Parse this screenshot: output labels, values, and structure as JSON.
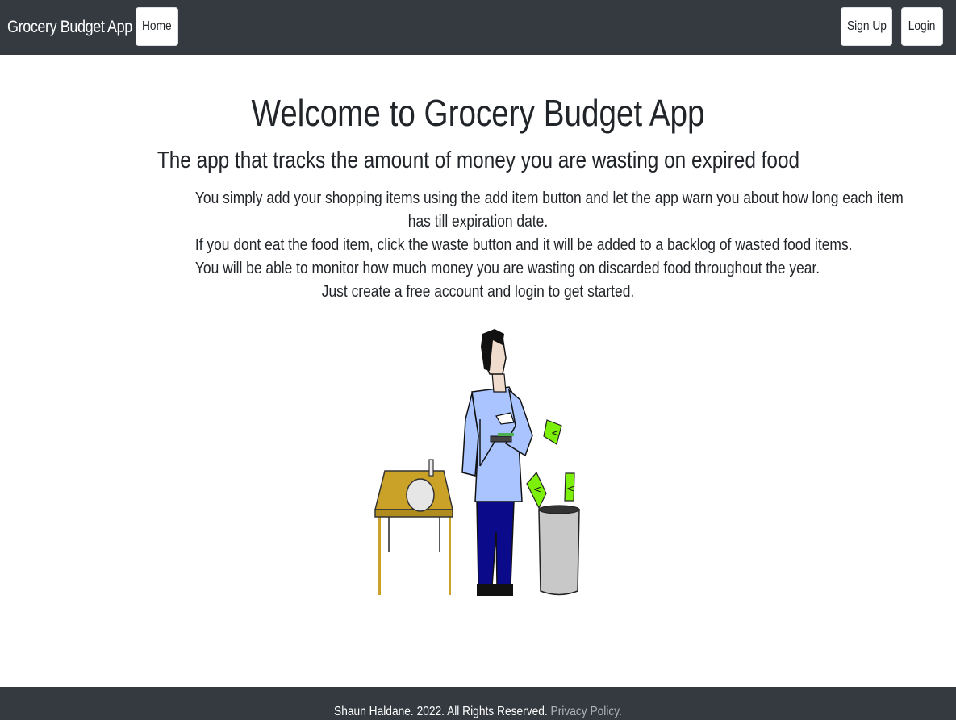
{
  "nav": {
    "brand": "Grocery Budget App",
    "home_label": "Home",
    "signup_label": "Sign Up",
    "login_label": "Login"
  },
  "hero": {
    "title": "Welcome to Grocery Budget App",
    "subtitle": "The app that tracks the amount of money you are wasting on expired food",
    "description_lines": [
      "You simply add your shopping items using the add item button and let the app warn you about how long each item",
      "has till expiration date.",
      "If you dont eat the food item, click the waste button and it will be added to a backlog of wasted food items.",
      "You will be able to monitor how much money you are wasting on discarded food throughout the year.",
      "Just create a free account and login to get started."
    ]
  },
  "footer": {
    "copyright": "Shaun Haldane. 2022. All Rights Reserved.",
    "privacy_label": "Privacy Policy."
  },
  "colors": {
    "navbar_bg": "#343a40",
    "footer_bg": "#343a40",
    "link_muted": "#adb5bd",
    "table": "#c9a227",
    "shirt": "#a9c4ff",
    "pants": "#0a0a8a",
    "money": "#7cf00a",
    "bin": "#c8c8c8"
  }
}
